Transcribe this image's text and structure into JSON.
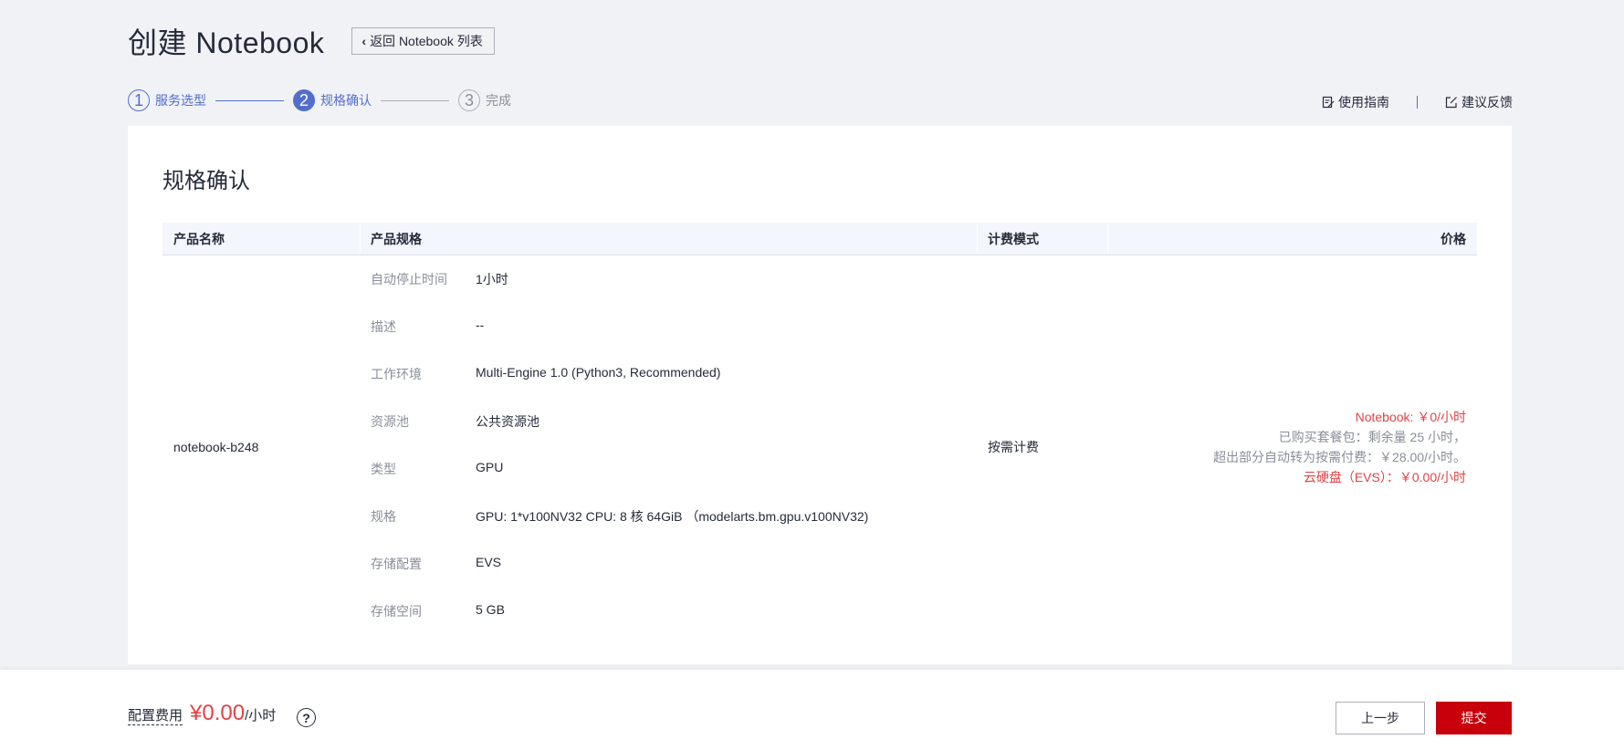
{
  "header": {
    "title": "创建 Notebook",
    "back_label": "返回 Notebook 列表"
  },
  "steps": [
    {
      "num": "1",
      "label": "服务选型"
    },
    {
      "num": "2",
      "label": "规格确认"
    },
    {
      "num": "3",
      "label": "完成"
    }
  ],
  "links": {
    "guide": "使用指南",
    "feedback": "建议反馈"
  },
  "card": {
    "title": "规格确认"
  },
  "table": {
    "headers": [
      "产品名称",
      "产品规格",
      "计费模式",
      "价格"
    ],
    "product_name": "notebook-b248",
    "specs": [
      {
        "label": "自动停止时间",
        "value": "1小时"
      },
      {
        "label": "描述",
        "value": "--"
      },
      {
        "label": "工作环境",
        "value": "Multi-Engine 1.0 (Python3, Recommended)"
      },
      {
        "label": "资源池",
        "value": "公共资源池"
      },
      {
        "label": "类型",
        "value": "GPU"
      },
      {
        "label": "规格",
        "value": "GPU: 1*v100NV32 CPU: 8 核 64GiB （modelarts.bm.gpu.v100NV32)"
      },
      {
        "label": "存储配置",
        "value": "EVS"
      },
      {
        "label": "存储空间",
        "value": "5 GB"
      }
    ],
    "billing_mode": "按需计费",
    "price": {
      "line1": "Notebook: ￥0/小时",
      "line2": "已购买套餐包：剩余量 25 小时，",
      "line3": "超出部分自动转为按需付费：￥28.00/小时。",
      "line4": "云硬盘（EVS）：￥0.00/小时"
    }
  },
  "footer": {
    "fee_label": "配置费用",
    "fee_amount": "¥0.00",
    "fee_unit": "/小时",
    "help": "?",
    "prev_label": "上一步",
    "submit_label": "提交"
  }
}
